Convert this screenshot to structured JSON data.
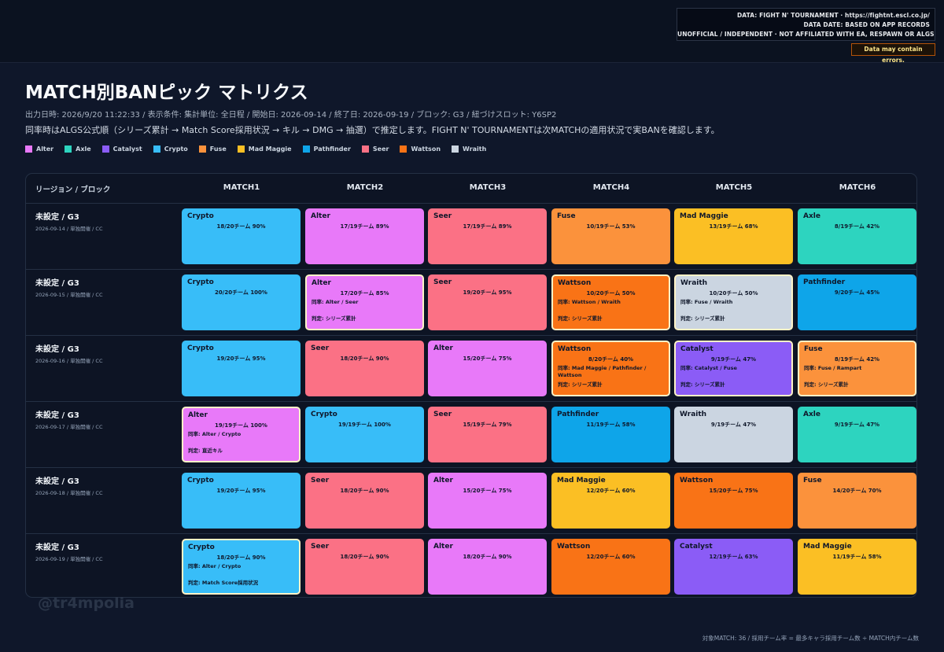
{
  "databox": {
    "line1": "DATA: FIGHT N' TOURNAMENT · https://fightnt.escl.co.jp/",
    "line2": "DATA DATE: BASED ON APP RECORDS",
    "line3": "UNOFFICIAL / INDEPENDENT · NOT AFFILIATED WITH EA, RESPAWN OR ALGS"
  },
  "warning": "Data may contain errors.",
  "title": "MATCH別BANピック マトリクス",
  "meta": "出力日時: 2026/9/20 11:22:33 / 表示条件: 集計単位: 全日程 / 開始日: 2026-09-14 / 終了日: 2026-09-19 / ブロック: G3 / 紐づけスロット: Y6SP2",
  "note": "同率時はALGS公式順（シリーズ累計 → Match Score採用状況 → キル → DMG → 抽選）で推定します。FIGHT N' TOURNAMENTは次MATCHの適用状況で実BANを確認します。",
  "legend": [
    {
      "label": "Alter",
      "color": "#e879f9"
    },
    {
      "label": "Axle",
      "color": "#2dd4bf"
    },
    {
      "label": "Catalyst",
      "color": "#8b5cf6"
    },
    {
      "label": "Crypto",
      "color": "#38bdf8"
    },
    {
      "label": "Fuse",
      "color": "#fb923c"
    },
    {
      "label": "Mad Maggie",
      "color": "#fbbf24"
    },
    {
      "label": "Pathfinder",
      "color": "#0ea5e9"
    },
    {
      "label": "Seer",
      "color": "#fb7185"
    },
    {
      "label": "Wattson",
      "color": "#f97316"
    },
    {
      "label": "Wraith",
      "color": "#cbd5e1"
    }
  ],
  "table": {
    "row_header": "リージョン / ブロック",
    "matches": [
      "MATCH1",
      "MATCH2",
      "MATCH3",
      "MATCH4",
      "MATCH5",
      "MATCH6"
    ],
    "rows": [
      {
        "label": "未設定 / G3",
        "sub": "2026-09-14 / 単独開催 / CC",
        "cells": [
          {
            "legend": "Crypto",
            "stat": "18/20チーム 90%"
          },
          {
            "legend": "Alter",
            "stat": "17/19チーム 89%"
          },
          {
            "legend": "Seer",
            "stat": "17/19チーム 89%"
          },
          {
            "legend": "Fuse",
            "stat": "10/19チーム 53%"
          },
          {
            "legend": "Mad Maggie",
            "stat": "13/19チーム 68%"
          },
          {
            "legend": "Axle",
            "stat": "8/19チーム 42%"
          }
        ]
      },
      {
        "label": "未設定 / G3",
        "sub": "2026-09-15 / 単独開催 / CC",
        "cells": [
          {
            "legend": "Crypto",
            "stat": "20/20チーム 100%"
          },
          {
            "legend": "Alter",
            "stat": "17/20チーム 85%",
            "tied": "同率: Alter / Seer",
            "judge": "判定: シリーズ累計"
          },
          {
            "legend": "Seer",
            "stat": "19/20チーム 95%"
          },
          {
            "legend": "Wattson",
            "stat": "10/20チーム 50%",
            "tied": "同率: Wattson / Wraith",
            "judge": "判定: シリーズ累計"
          },
          {
            "legend": "Wraith",
            "stat": "10/20チーム 50%",
            "tied": "同率: Fuse / Wraith",
            "judge": "判定: シリーズ累計"
          },
          {
            "legend": "Pathfinder",
            "stat": "9/20チーム 45%"
          }
        ]
      },
      {
        "label": "未設定 / G3",
        "sub": "2026-09-16 / 単独開催 / CC",
        "cells": [
          {
            "legend": "Crypto",
            "stat": "19/20チーム 95%"
          },
          {
            "legend": "Seer",
            "stat": "18/20チーム 90%"
          },
          {
            "legend": "Alter",
            "stat": "15/20チーム 75%"
          },
          {
            "legend": "Wattson",
            "stat": "8/20チーム 40%",
            "tied": "同率: Mad Maggie / Pathfinder / Wattson",
            "judge": "判定: シリーズ累計"
          },
          {
            "legend": "Catalyst",
            "stat": "9/19チーム 47%",
            "tied": "同率: Catalyst / Fuse",
            "judge": "判定: シリーズ累計"
          },
          {
            "legend": "Fuse",
            "stat": "8/19チーム 42%",
            "tied": "同率: Fuse / Rampart",
            "judge": "判定: シリーズ累計"
          }
        ]
      },
      {
        "label": "未設定 / G3",
        "sub": "2026-09-17 / 単独開催 / CC",
        "cells": [
          {
            "legend": "Alter",
            "stat": "19/19チーム 100%",
            "tied": "同率: Alter / Crypto",
            "judge": "判定: 直近キル"
          },
          {
            "legend": "Crypto",
            "stat": "19/19チーム 100%"
          },
          {
            "legend": "Seer",
            "stat": "15/19チーム 79%"
          },
          {
            "legend": "Pathfinder",
            "stat": "11/19チーム 58%"
          },
          {
            "legend": "Wraith",
            "stat": "9/19チーム 47%"
          },
          {
            "legend": "Axle",
            "stat": "9/19チーム 47%"
          }
        ]
      },
      {
        "label": "未設定 / G3",
        "sub": "2026-09-18 / 単独開催 / CC",
        "cells": [
          {
            "legend": "Crypto",
            "stat": "19/20チーム 95%"
          },
          {
            "legend": "Seer",
            "stat": "18/20チーム 90%"
          },
          {
            "legend": "Alter",
            "stat": "15/20チーム 75%"
          },
          {
            "legend": "Mad Maggie",
            "stat": "12/20チーム 60%"
          },
          {
            "legend": "Wattson",
            "stat": "15/20チーム 75%"
          },
          {
            "legend": "Fuse",
            "stat": "14/20チーム 70%"
          }
        ]
      },
      {
        "label": "未設定 / G3",
        "sub": "2026-09-19 / 単独開催 / CC",
        "cells": [
          {
            "legend": "Crypto",
            "stat": "18/20チーム 90%",
            "tied": "同率: Alter / Crypto",
            "judge": "判定: Match Score採用状況"
          },
          {
            "legend": "Seer",
            "stat": "18/20チーム 90%"
          },
          {
            "legend": "Alter",
            "stat": "18/20チーム 90%"
          },
          {
            "legend": "Wattson",
            "stat": "12/20チーム 60%"
          },
          {
            "legend": "Catalyst",
            "stat": "12/19チーム 63%"
          },
          {
            "legend": "Mad Maggie",
            "stat": "11/19チーム 58%"
          }
        ]
      }
    ]
  },
  "watermark": "@tr4mpolia",
  "footer": "対象MATCH: 36 / 採用チーム率 = 最多キャラ採用チーム数 ÷ MATCH内チーム数"
}
